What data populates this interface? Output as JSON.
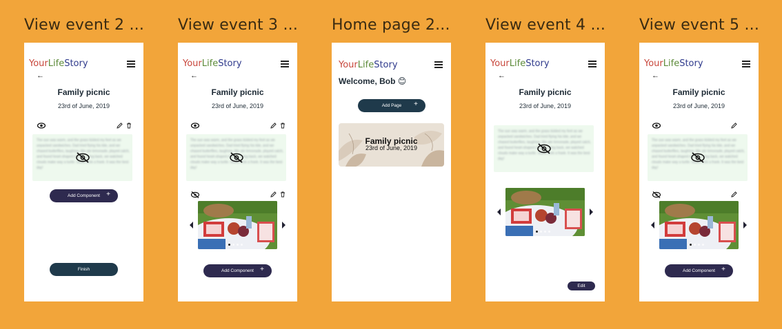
{
  "frames": [
    {
      "label": "View event 2 ..."
    },
    {
      "label": "View event 3 ..."
    },
    {
      "label": "Home page 2..."
    },
    {
      "label": "View event 4 ..."
    },
    {
      "label": "View event 5 ..."
    }
  ],
  "logo": {
    "part1": "Your",
    "part2": "Life",
    "part3": "Story"
  },
  "event": {
    "title": "Family picnic",
    "date": "23rd of June, 2019"
  },
  "blurred_text": "The sun was warm, and the grass tickled my feet as we unpacked sandwiches. Dad tried flying his kite, and we chased butterflies, laughing. We ate lemonade, played catch, and found heart-shaped clouds. Lying back, we watched clouds make way a turtle. Starts took a frank. It was the best day!",
  "buttons": {
    "add_component": "Add Component",
    "finish": "Finish",
    "add_page": "Add Page",
    "edit": "Edit",
    "plus": "+"
  },
  "home": {
    "welcome": "Welcome, Bob 😊"
  },
  "colors": {
    "background": "#F2A53A",
    "navy": "#2E2A4F",
    "teal": "#1F3A4B",
    "card": "#E9E1D6",
    "textblock": "#EEF9EE"
  },
  "icons": [
    "eye-icon",
    "eye-off-icon",
    "pencil-icon",
    "trash-icon",
    "back-arrow-icon",
    "menu-icon",
    "plus-icon",
    "chevron-left-icon",
    "chevron-right-icon"
  ]
}
